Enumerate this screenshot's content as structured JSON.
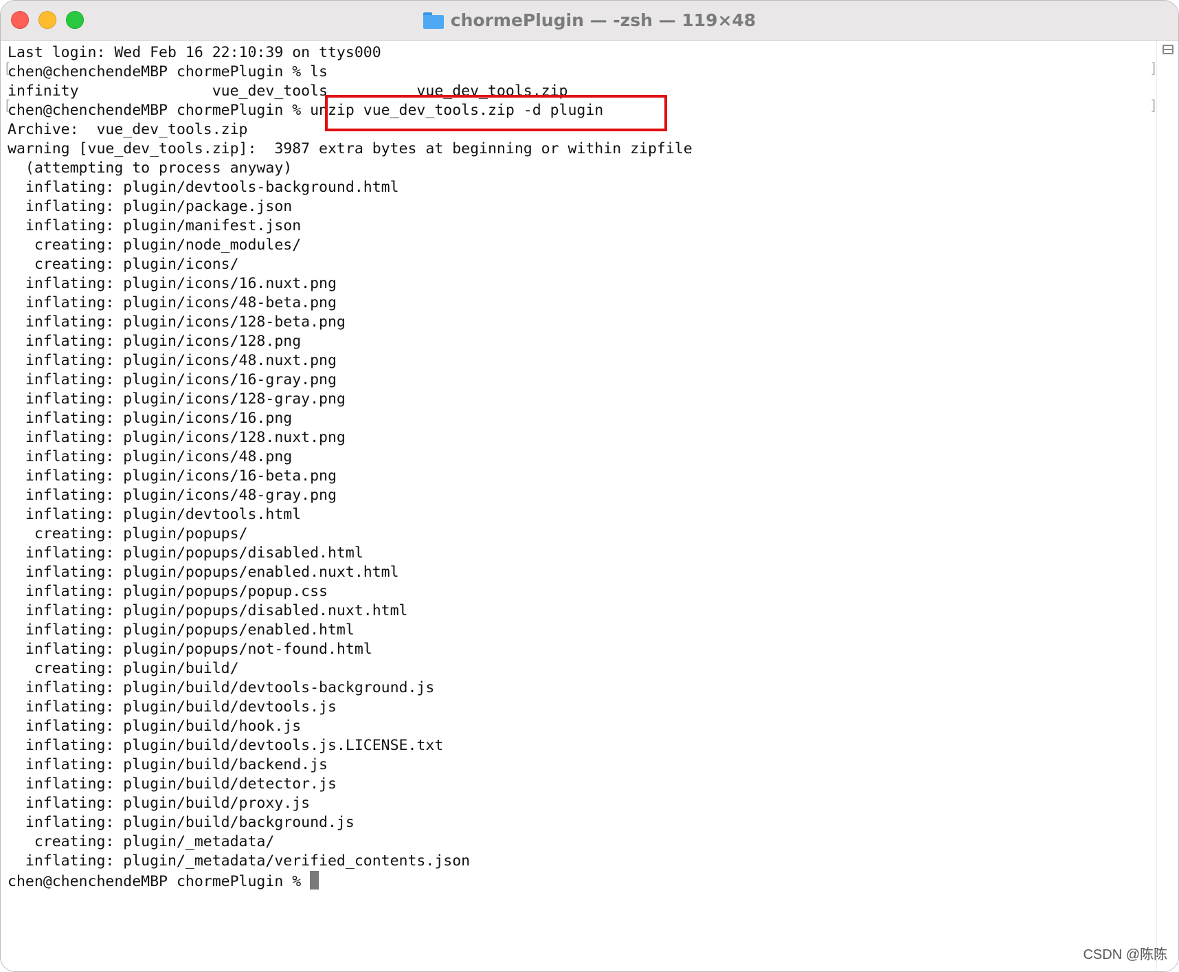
{
  "window": {
    "title": "chormePlugin — -zsh — 119×48"
  },
  "terminal": {
    "lines": [
      "Last login: Wed Feb 16 22:10:39 on ttys000",
      "chen@chenchendeMBP chormePlugin % ls",
      "infinity               vue_dev_tools          vue_dev_tools.zip",
      "chen@chenchendeMBP chormePlugin % unzip vue_dev_tools.zip -d plugin",
      "Archive:  vue_dev_tools.zip",
      "warning [vue_dev_tools.zip]:  3987 extra bytes at beginning or within zipfile",
      "  (attempting to process anyway)",
      "  inflating: plugin/devtools-background.html",
      "  inflating: plugin/package.json",
      "  inflating: plugin/manifest.json",
      "   creating: plugin/node_modules/",
      "   creating: plugin/icons/",
      "  inflating: plugin/icons/16.nuxt.png",
      "  inflating: plugin/icons/48-beta.png",
      "  inflating: plugin/icons/128-beta.png",
      "  inflating: plugin/icons/128.png",
      "  inflating: plugin/icons/48.nuxt.png",
      "  inflating: plugin/icons/16-gray.png",
      "  inflating: plugin/icons/128-gray.png",
      "  inflating: plugin/icons/16.png",
      "  inflating: plugin/icons/128.nuxt.png",
      "  inflating: plugin/icons/48.png",
      "  inflating: plugin/icons/16-beta.png",
      "  inflating: plugin/icons/48-gray.png",
      "  inflating: plugin/devtools.html",
      "   creating: plugin/popups/",
      "  inflating: plugin/popups/disabled.html",
      "  inflating: plugin/popups/enabled.nuxt.html",
      "  inflating: plugin/popups/popup.css",
      "  inflating: plugin/popups/disabled.nuxt.html",
      "  inflating: plugin/popups/enabled.html",
      "  inflating: plugin/popups/not-found.html",
      "   creating: plugin/build/",
      "  inflating: plugin/build/devtools-background.js",
      "  inflating: plugin/build/devtools.js",
      "  inflating: plugin/build/hook.js",
      "  inflating: plugin/build/devtools.js.LICENSE.txt",
      "  inflating: plugin/build/backend.js",
      "  inflating: plugin/build/detector.js",
      "  inflating: plugin/build/proxy.js",
      "  inflating: plugin/build/background.js",
      "   creating: plugin/_metadata/",
      "  inflating: plugin/_metadata/verified_contents.json"
    ],
    "prompt": "chen@chenchendeMBP chormePlugin % "
  },
  "watermark": "CSDN @陈陈",
  "colors": {
    "highlight": "#e01010",
    "titlebar": "#e9e7e7",
    "text": "#111111"
  },
  "icons": [
    "close-icon",
    "minimize-icon",
    "maximize-icon",
    "folder-icon",
    "split-pane-icon"
  ]
}
